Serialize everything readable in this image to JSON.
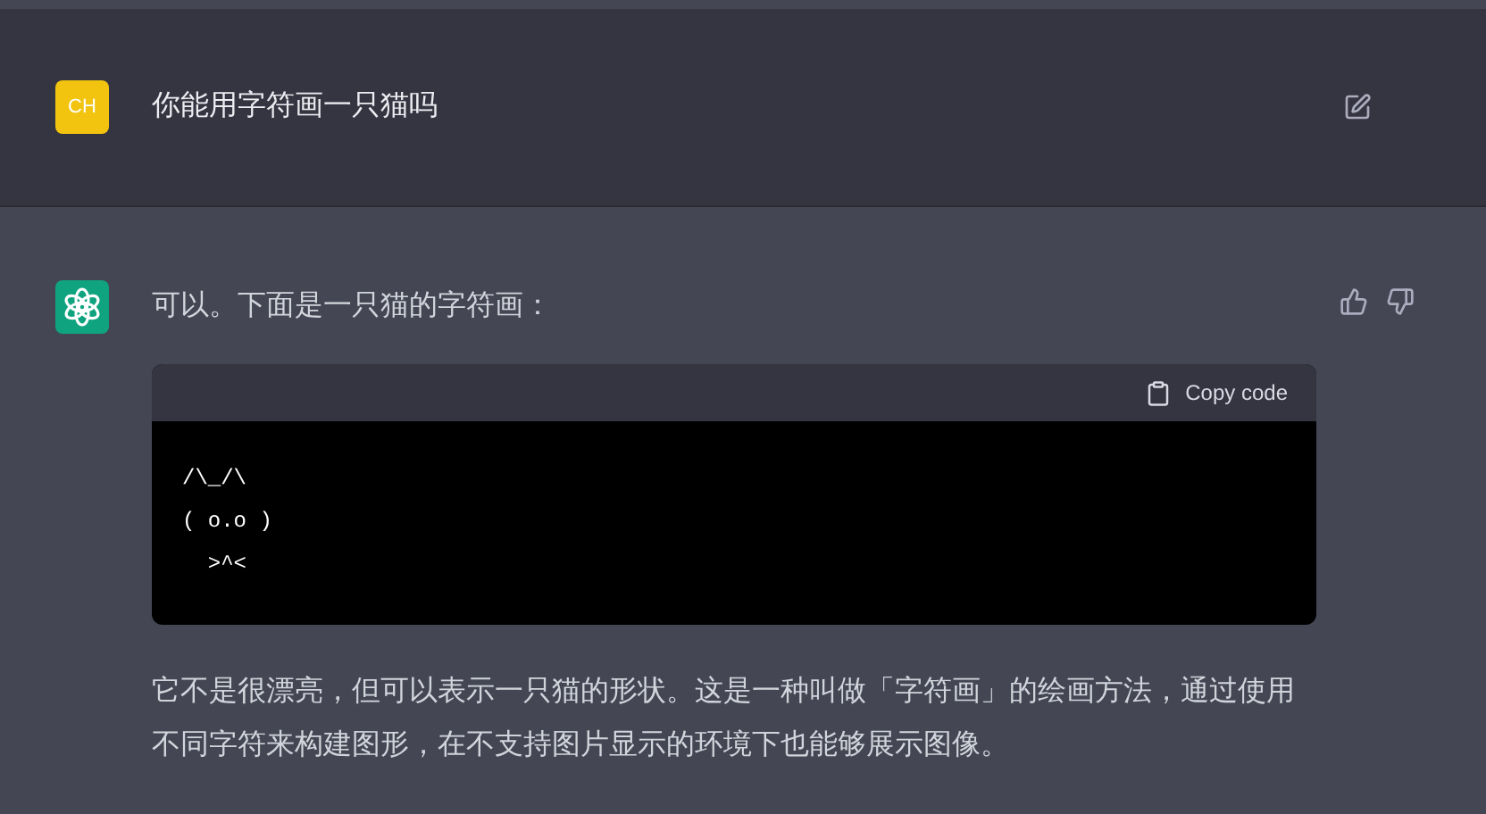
{
  "user_message": {
    "avatar": "CH",
    "text": "你能用字符画一只猫吗"
  },
  "assistant_message": {
    "intro": "可以。下面是一只猫的字符画：",
    "code_block": {
      "copy_label": "Copy code",
      "lines": [
        "/\\_/\\",
        "( o.o )",
        "  >^<"
      ]
    },
    "paragraph": "它不是很漂亮，但可以表示一只猫的形状。这是一种叫做「字符画」的绘画方法，通过使用不同字符来构建图形，在不支持图片显示的环境下也能够展示图像。"
  }
}
